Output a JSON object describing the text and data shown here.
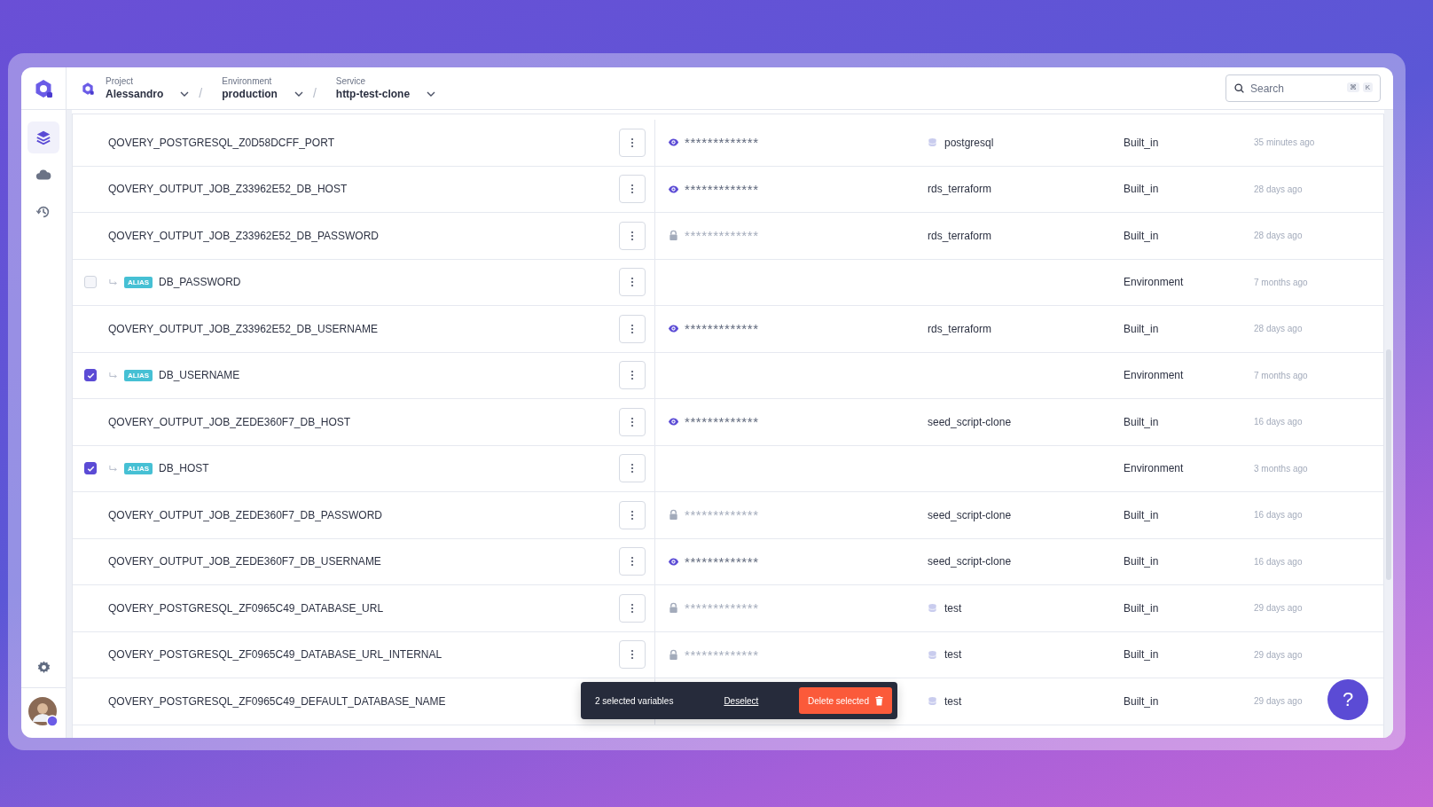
{
  "breadcrumb": [
    {
      "label": "Project",
      "value": "Alessandro"
    },
    {
      "separator": "/",
      "label": "Environment",
      "value": "production"
    },
    {
      "separator": "/",
      "label": "Service",
      "value": "http-test-clone"
    }
  ],
  "search": {
    "placeholder": "Search",
    "shortcut": [
      "⌘",
      "K"
    ]
  },
  "sidebar": {
    "items": [
      {
        "kind": "layers",
        "selected": true
      },
      {
        "kind": "cloud",
        "selected": false
      },
      {
        "kind": "history",
        "selected": false
      }
    ]
  },
  "rows": [
    {
      "kind": "variable",
      "name": "QOVERY_POSTGRESQL_Z0D58DCFF_PORT",
      "value": "*************",
      "secret": false,
      "service": "postgresql",
      "database": true,
      "scope": "Built_in",
      "updated": "35 minutes ago"
    },
    {
      "kind": "variable",
      "name": "QOVERY_OUTPUT_JOB_Z33962E52_DB_HOST",
      "value": "*************",
      "secret": false,
      "service": "rds_terraform",
      "database": false,
      "scope": "Built_in",
      "updated": "28 days ago"
    },
    {
      "kind": "variable",
      "name": "QOVERY_OUTPUT_JOB_Z33962E52_DB_PASSWORD",
      "value": "*************",
      "secret": true,
      "service": "rds_terraform",
      "database": false,
      "scope": "Built_in",
      "updated": "28 days ago"
    },
    {
      "kind": "alias",
      "name": "DB_PASSWORD",
      "badge": "ALIAS",
      "checked": false,
      "scope": "Environment",
      "updated": "7 months ago"
    },
    {
      "kind": "variable",
      "name": "QOVERY_OUTPUT_JOB_Z33962E52_DB_USERNAME",
      "value": "*************",
      "secret": false,
      "service": "rds_terraform",
      "database": false,
      "scope": "Built_in",
      "updated": "28 days ago"
    },
    {
      "kind": "alias",
      "name": "DB_USERNAME",
      "badge": "ALIAS",
      "checked": true,
      "scope": "Environment",
      "updated": "7 months ago"
    },
    {
      "kind": "variable",
      "name": "QOVERY_OUTPUT_JOB_ZEDE360F7_DB_HOST",
      "value": "*************",
      "secret": false,
      "service": "seed_script-clone",
      "database": false,
      "scope": "Built_in",
      "updated": "16 days ago"
    },
    {
      "kind": "alias",
      "name": "DB_HOST",
      "badge": "ALIAS",
      "checked": true,
      "scope": "Environment",
      "updated": "3 months ago"
    },
    {
      "kind": "variable",
      "name": "QOVERY_OUTPUT_JOB_ZEDE360F7_DB_PASSWORD",
      "value": "*************",
      "secret": true,
      "service": "seed_script-clone",
      "database": false,
      "scope": "Built_in",
      "updated": "16 days ago"
    },
    {
      "kind": "variable",
      "name": "QOVERY_OUTPUT_JOB_ZEDE360F7_DB_USERNAME",
      "value": "*************",
      "secret": false,
      "service": "seed_script-clone",
      "database": false,
      "scope": "Built_in",
      "updated": "16 days ago"
    },
    {
      "kind": "variable",
      "name": "QOVERY_POSTGRESQL_ZF0965C49_DATABASE_URL",
      "value": "*************",
      "secret": true,
      "service": "test",
      "database": true,
      "scope": "Built_in",
      "updated": "29 days ago"
    },
    {
      "kind": "variable",
      "name": "QOVERY_POSTGRESQL_ZF0965C49_DATABASE_URL_INTERNAL",
      "value": "*************",
      "secret": true,
      "service": "test",
      "database": true,
      "scope": "Built_in",
      "updated": "29 days ago"
    },
    {
      "kind": "variable",
      "name": "QOVERY_POSTGRESQL_ZF0965C49_DEFAULT_DATABASE_NAME",
      "menu": false,
      "service": "test",
      "database": true,
      "scope": "Built_in",
      "updated": "29 days ago"
    }
  ],
  "selection_bar": {
    "count": "2 selected variables",
    "deselect": "Deselect",
    "delete": "Delete selected"
  },
  "help": {
    "label": "?"
  }
}
